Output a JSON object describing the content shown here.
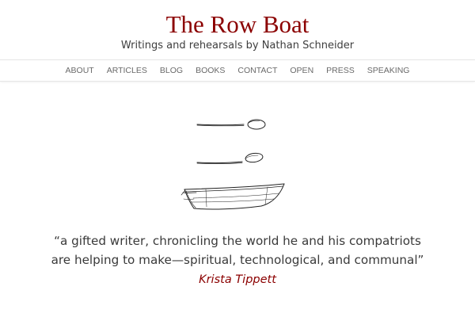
{
  "site": {
    "title": "The Row Boat",
    "description": "Writings and rehearsals by Nathan Schneider",
    "accent_color": "#8b0000"
  },
  "nav": {
    "items": [
      {
        "label": "ABOUT"
      },
      {
        "label": "ARTICLES"
      },
      {
        "label": "BLOG"
      },
      {
        "label": "BOOKS"
      },
      {
        "label": "CONTACT"
      },
      {
        "label": "OPEN"
      },
      {
        "label": "PRESS"
      },
      {
        "label": "SPEAKING"
      }
    ]
  },
  "hero": {
    "illustration": "hand-drawn spoons and rowboat sketch"
  },
  "quote": {
    "line1": "“a gifted writer, chronicling the world he and his compatriots",
    "line2": "are helping to make—spiritual, technological, and communal”",
    "author": "Krista Tippett"
  }
}
